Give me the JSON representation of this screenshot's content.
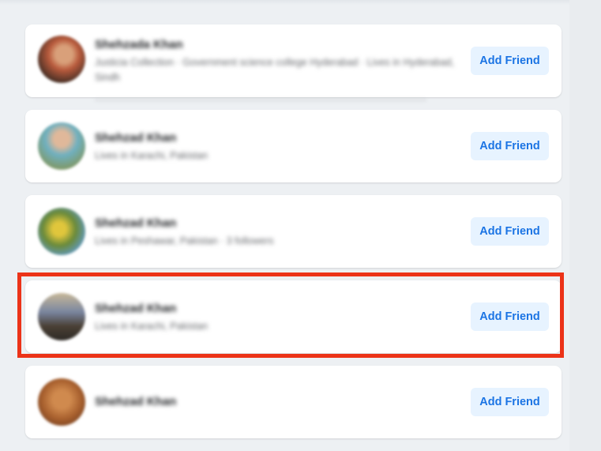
{
  "suggestions": [
    {
      "name": "Shehzada Khan",
      "subtitle": "Justicia Collection · Government science college Hyderabad · Lives in Hyderabad, Sindh",
      "button_label": "Add Friend",
      "avatar_colors": [
        "#b85a3c",
        "#3a2a22",
        "#d9a07a"
      ]
    },
    {
      "name": "Shehzad Khan",
      "subtitle": "Lives in Karachi, Pakistan",
      "button_label": "Add Friend",
      "avatar_colors": [
        "#6fb0c0",
        "#c9d3a8",
        "#7e9a6e"
      ]
    },
    {
      "name": "Shehzad Khan",
      "subtitle": "Lives in Peshawar, Pakistan · 3 followers",
      "button_label": "Add Friend",
      "avatar_colors": [
        "#5f9bd0",
        "#e0c63c",
        "#6a8a3a"
      ]
    },
    {
      "name": "Shehzad Khan",
      "subtitle": "Lives in Karachi, Pakistan",
      "button_label": "Add Friend",
      "avatar_colors": [
        "#7a86a0",
        "#4a4035",
        "#c8b898"
      ]
    },
    {
      "name": "Shehzad Khan",
      "subtitle": "",
      "button_label": "Add Friend",
      "avatar_colors": [
        "#a8602e",
        "#6b3a1e",
        "#d08a4e"
      ]
    }
  ],
  "highlight_color": "#ec3318",
  "accent_color": "#1b74e4"
}
